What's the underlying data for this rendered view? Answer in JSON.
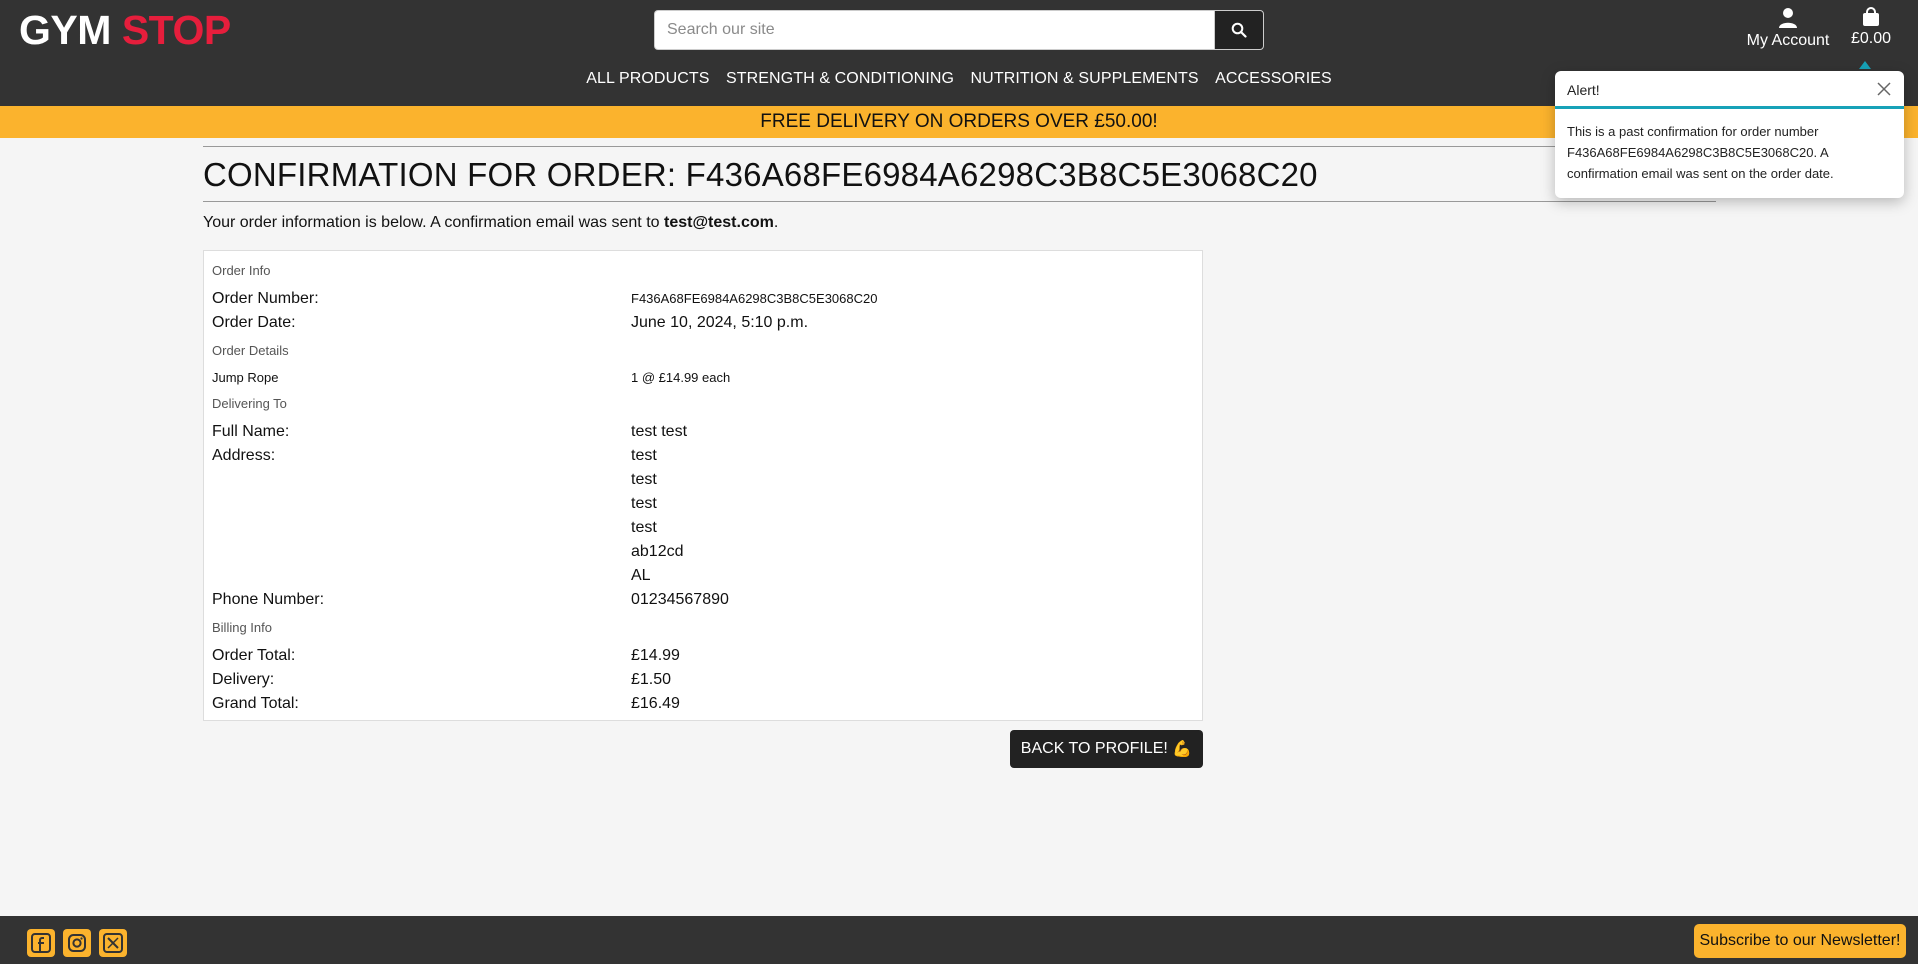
{
  "header": {
    "logo_part1": "GYM",
    "logo_part2": "STOP",
    "search_placeholder": "Search our site",
    "account_label": "My Account",
    "bag_total": "£0.00",
    "brand_red": "#e61e3c",
    "accent_yellow": "#fbb32d"
  },
  "nav": {
    "items": [
      {
        "label": "ALL PRODUCTS"
      },
      {
        "label": "STRENGTH & CONDITIONING"
      },
      {
        "label": "NUTRITION & SUPPLEMENTS"
      },
      {
        "label": "ACCESSORIES"
      }
    ]
  },
  "promo": {
    "text": "FREE DELIVERY ON ORDERS OVER £50.00!"
  },
  "page": {
    "title": "CONFIRMATION FOR ORDER: F436A68FE6984A6298C3B8C5E3068C20",
    "intro_text": "Your order information is below. A confirmation email was sent to ",
    "intro_email": "test@test.com",
    "intro_end": "."
  },
  "order": {
    "section_info": "Order Info",
    "number_label": "Order Number:",
    "number_value": "F436A68FE6984A6298C3B8C5E3068C20",
    "date_label": "Order Date:",
    "date_value": "June 10, 2024, 5:10 p.m.",
    "section_details": "Order Details",
    "item_name": "Jump Rope",
    "item_qty_price": "1 @ £14.99 each",
    "section_delivery": "Delivering To",
    "fullname_label": "Full Name:",
    "fullname_value": "test test",
    "address_label": "Address:",
    "address_lines": [
      "test",
      "test",
      "test",
      "test",
      "ab12cd",
      "AL"
    ],
    "phone_label": "Phone Number:",
    "phone_value": "01234567890",
    "section_billing": "Billing Info",
    "total_label": "Order Total:",
    "total_value": "£14.99",
    "delivery_label": "Delivery:",
    "delivery_value": "£1.50",
    "grand_label": "Grand Total:",
    "grand_value": "£16.49"
  },
  "back_button": {
    "label": "BACK TO PROFILE!",
    "emoji": "💪"
  },
  "toast": {
    "title": "Alert!",
    "message": "This is a past confirmation for order number F436A68FE6984A6298C3B8C5E3068C20. A confirmation email was sent on the order date.",
    "accent": "#17a2b8"
  },
  "footer": {
    "social_icons": [
      "facebook-icon",
      "instagram-icon",
      "x-icon"
    ],
    "newsletter_label": "Subscribe to our Newsletter!"
  }
}
